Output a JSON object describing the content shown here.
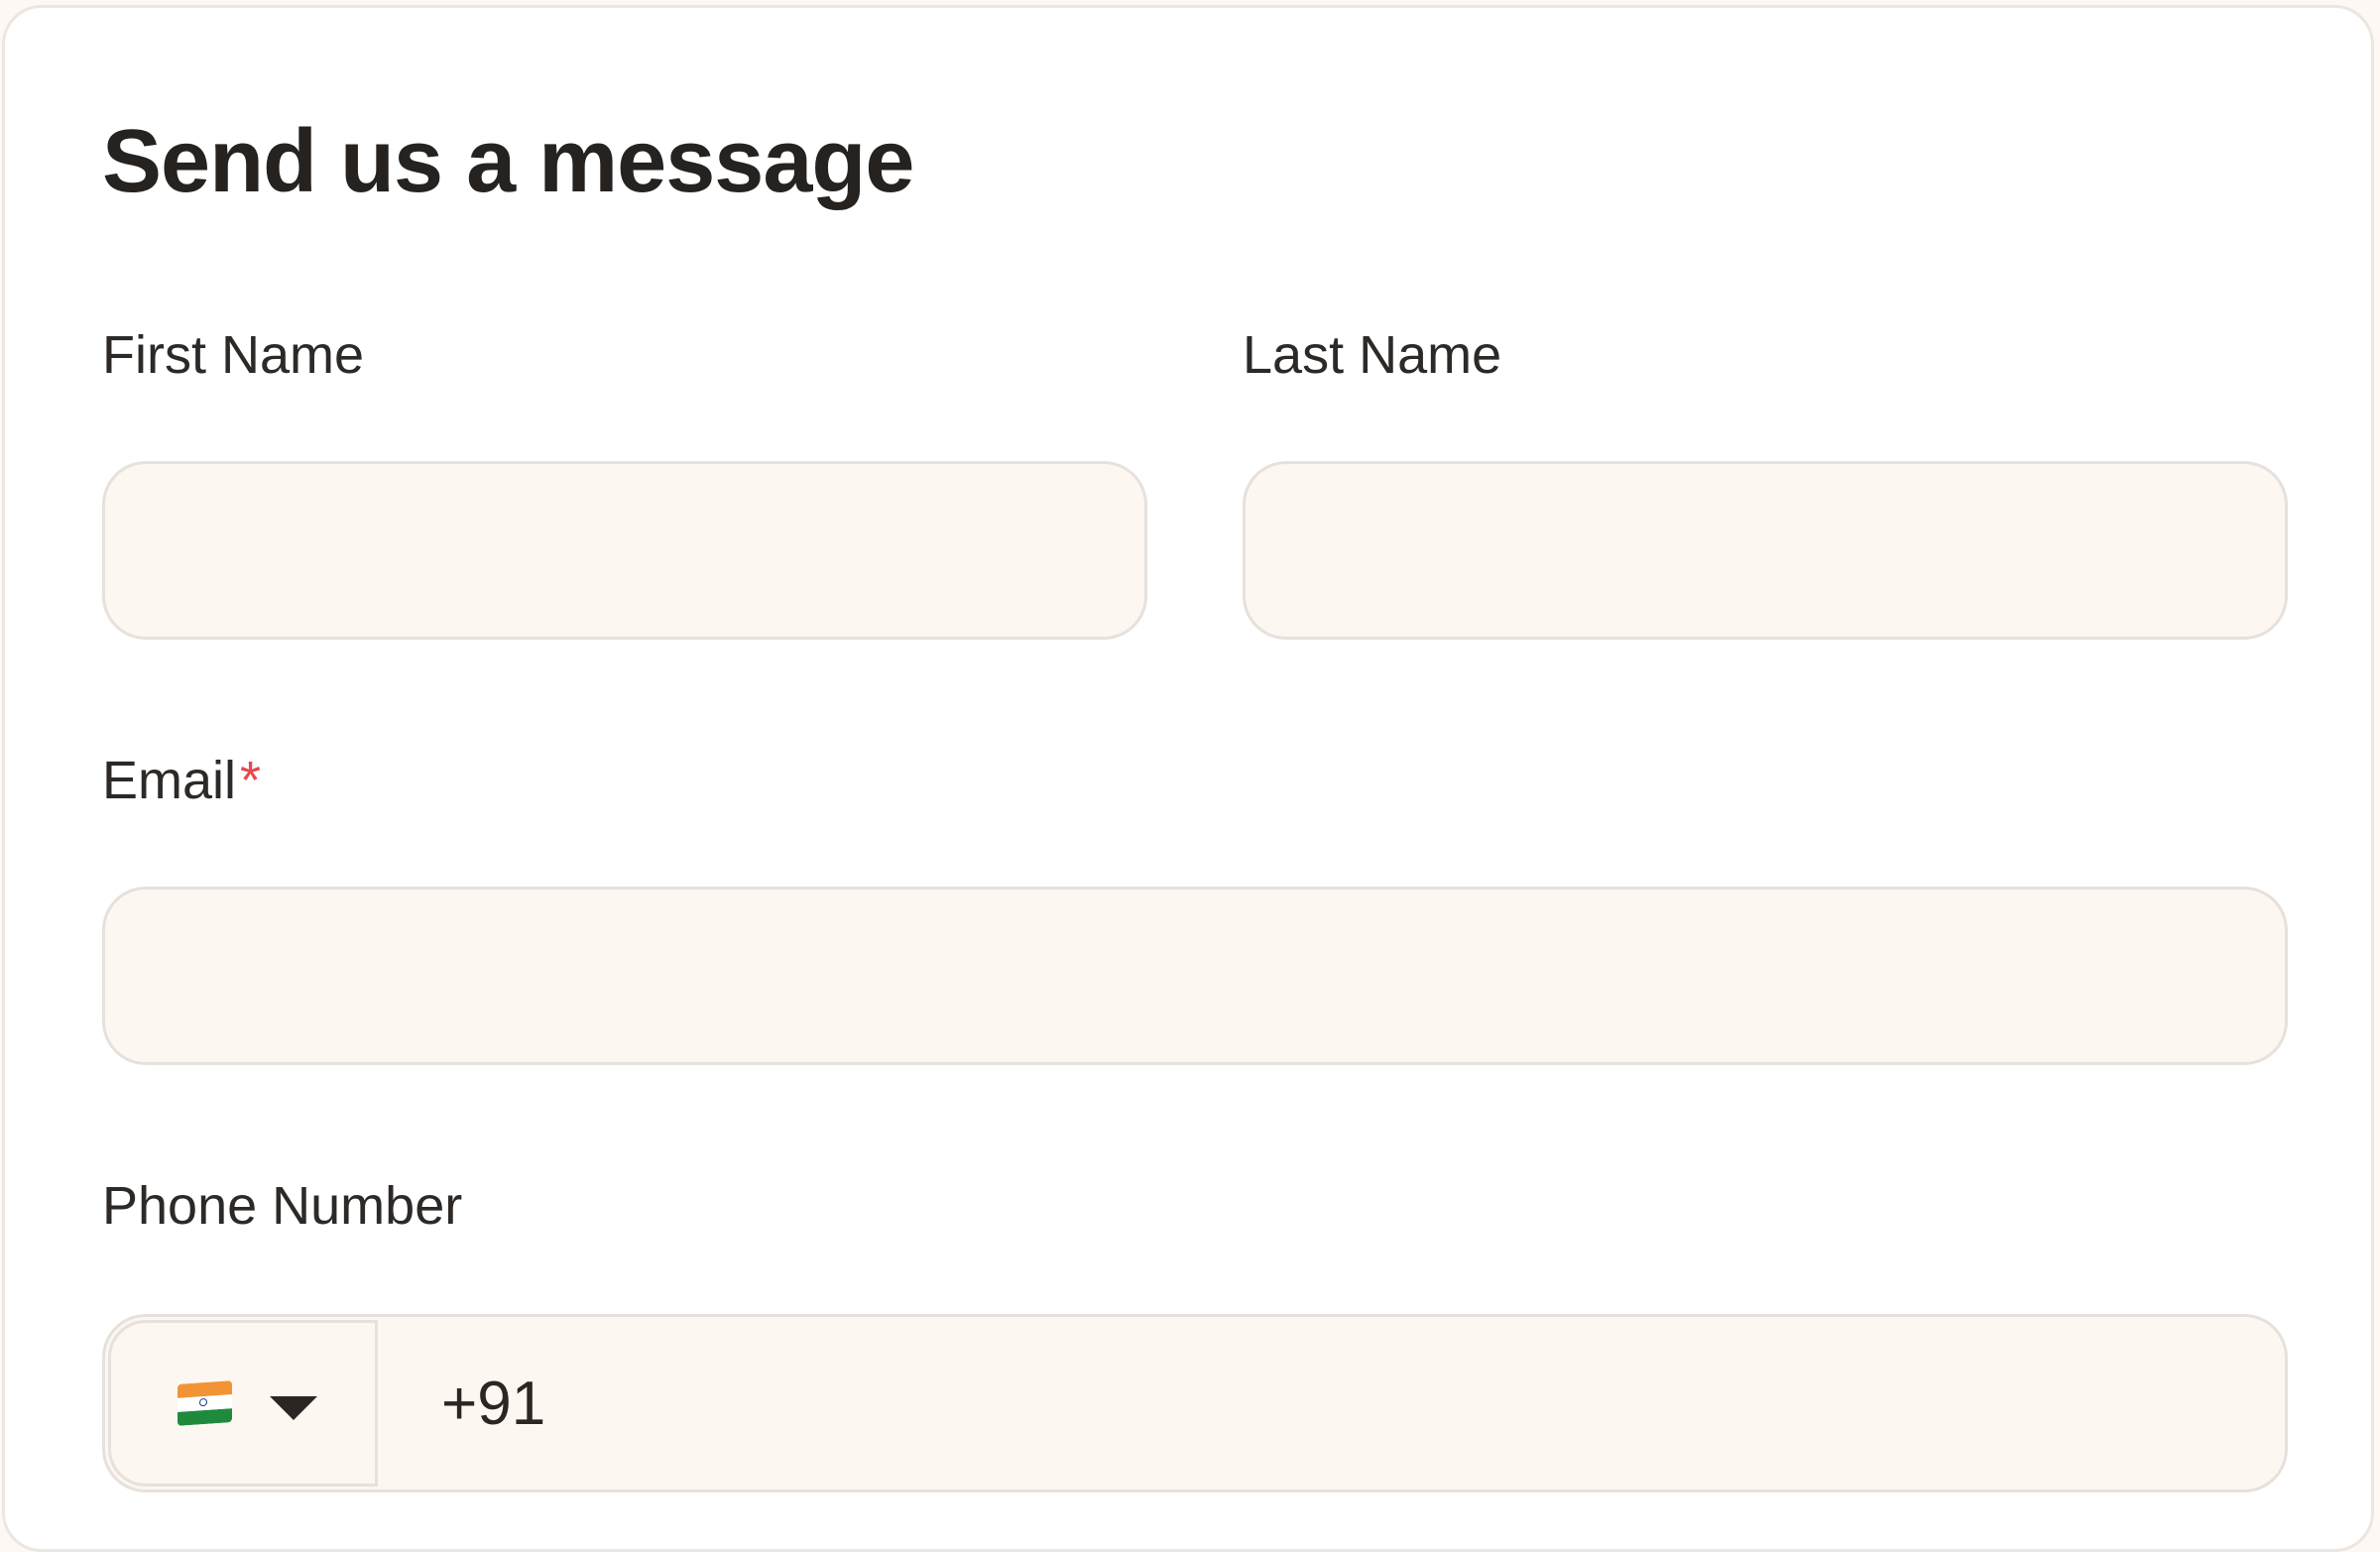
{
  "form": {
    "title": "Send us a message",
    "first_name": {
      "label": "First Name",
      "value": ""
    },
    "last_name": {
      "label": "Last Name",
      "value": ""
    },
    "email": {
      "label": "Email",
      "required_mark": "*",
      "value": ""
    },
    "phone": {
      "label": "Phone Number",
      "country_flag_icon": "india-flag-icon",
      "dropdown_icon": "caret-down-icon",
      "value": "+91"
    }
  },
  "colors": {
    "card_background": "#ffffff",
    "input_background": "#fdf7f1",
    "input_border": "#e6e1dc",
    "required_mark": "#e5484d",
    "text": "#2b2623"
  }
}
